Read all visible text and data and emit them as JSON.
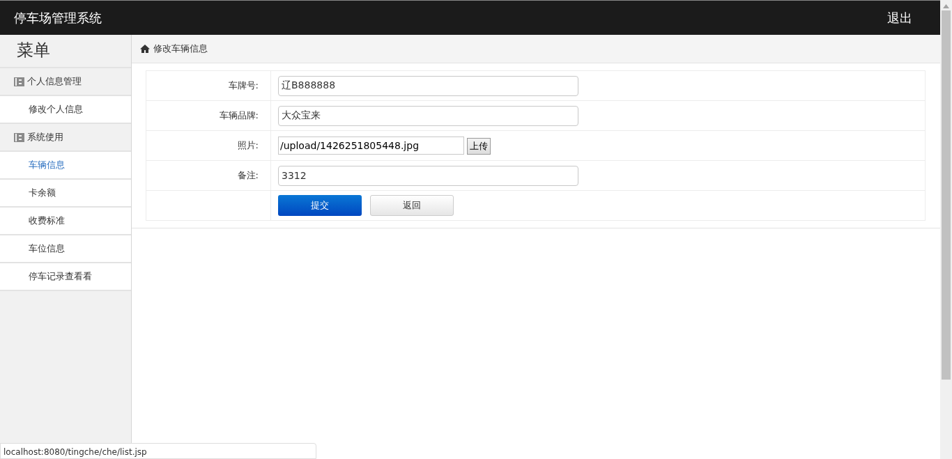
{
  "header": {
    "title": "停车场管理系统",
    "logout": "退出"
  },
  "sidebar": {
    "title": "菜单",
    "items": [
      {
        "kind": "group",
        "label": "个人信息管理"
      },
      {
        "kind": "item",
        "label": "修改个人信息",
        "selected": false
      },
      {
        "kind": "group",
        "label": "系统使用"
      },
      {
        "kind": "item",
        "label": "车辆信息",
        "selected": true
      },
      {
        "kind": "item",
        "label": "卡余额",
        "selected": false
      },
      {
        "kind": "item",
        "label": "收费标准",
        "selected": false
      },
      {
        "kind": "item",
        "label": "车位信息",
        "selected": false
      },
      {
        "kind": "item",
        "label": "停车记录查看看",
        "selected": false
      }
    ]
  },
  "breadcrumb": "修改车辆信息",
  "form": {
    "fields": [
      {
        "kind": "text",
        "label": "车牌号:",
        "value": "辽B888888"
      },
      {
        "kind": "text",
        "label": "车辆品牌:",
        "value": "大众宝来"
      },
      {
        "kind": "file",
        "label": "照片:",
        "value": "/upload/1426251805448.jpg",
        "button": "上传"
      },
      {
        "kind": "text",
        "label": "备注:",
        "value": "3312"
      }
    ],
    "submit": "提交",
    "back": "返回"
  },
  "status_url": "localhost:8080/tingche/che/list.jsp"
}
